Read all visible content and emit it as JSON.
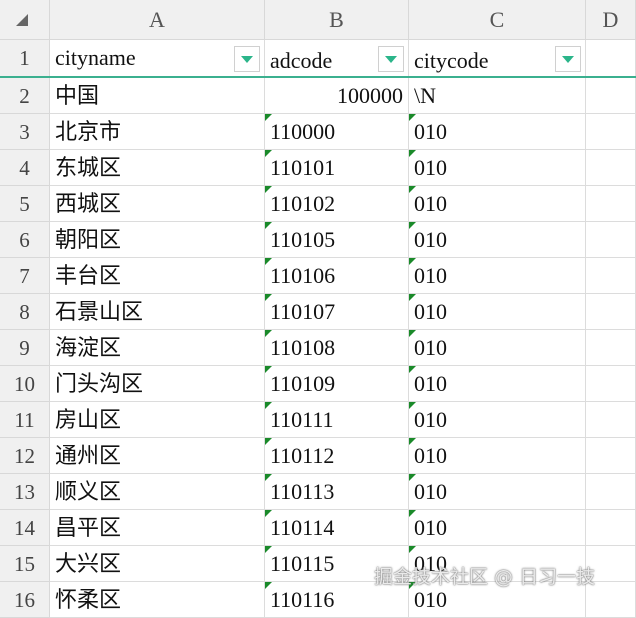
{
  "columns": [
    "A",
    "B",
    "C",
    "D"
  ],
  "headers": [
    "cityname",
    "adcode",
    "citycode"
  ],
  "rows": [
    [
      "1",
      "",
      "",
      ""
    ],
    [
      "2",
      "中国",
      "100000",
      "\\N"
    ],
    [
      "3",
      "北京市",
      "110000",
      "010"
    ],
    [
      "4",
      "东城区",
      "110101",
      "010"
    ],
    [
      "5",
      "西城区",
      "110102",
      "010"
    ],
    [
      "6",
      "朝阳区",
      "110105",
      "010"
    ],
    [
      "7",
      "丰台区",
      "110106",
      "010"
    ],
    [
      "8",
      "石景山区",
      "110107",
      "010"
    ],
    [
      "9",
      "海淀区",
      "110108",
      "010"
    ],
    [
      "10",
      "门头沟区",
      "110109",
      "010"
    ],
    [
      "11",
      "房山区",
      "110111",
      "010"
    ],
    [
      "12",
      "通州区",
      "110112",
      "010"
    ],
    [
      "13",
      "顺义区",
      "110113",
      "010"
    ],
    [
      "14",
      "昌平区",
      "110114",
      "010"
    ],
    [
      "15",
      "大兴区",
      "110115",
      "010"
    ],
    [
      "16",
      "怀柔区",
      "110116",
      "010"
    ]
  ],
  "watermark": "掘金技术社区 @ 日习一技"
}
